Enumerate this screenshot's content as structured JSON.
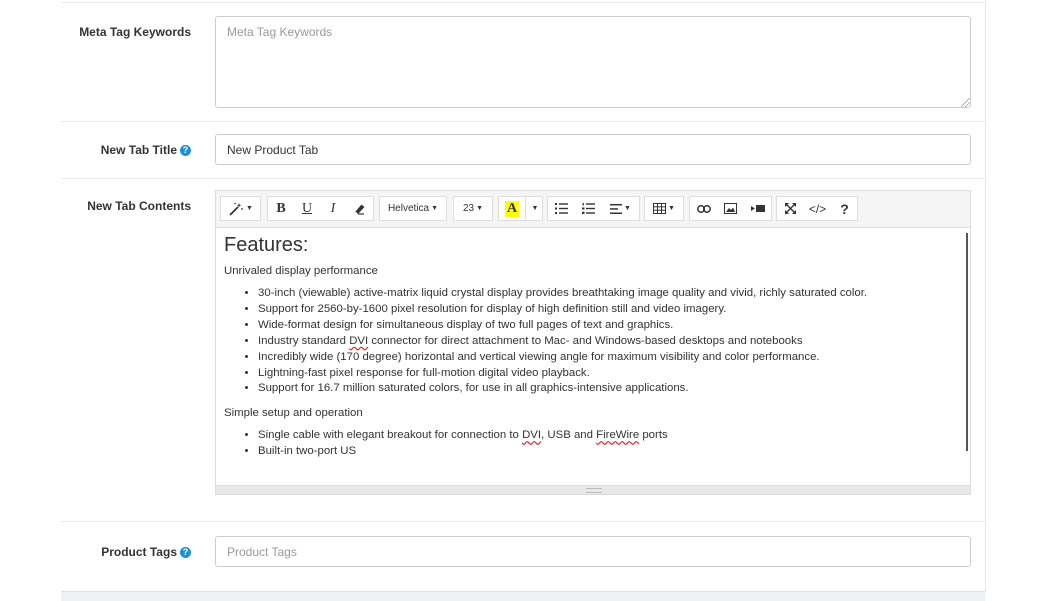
{
  "form": {
    "meta_keywords": {
      "label": "Meta Tag Keywords",
      "placeholder": "Meta Tag Keywords"
    },
    "new_tab_title": {
      "label": "New Tab Title",
      "value": "New Product Tab",
      "help_icon": "question-circle-icon"
    },
    "new_tab_contents": {
      "label": "New Tab Contents"
    },
    "product_tags": {
      "label": "Product Tags",
      "placeholder": "Product Tags",
      "help_icon": "question-circle-icon"
    }
  },
  "toolbar": {
    "style_icon": "magic-wand-icon",
    "bold": "B",
    "underline": "U",
    "italic": "I",
    "eraser_icon": "eraser-icon",
    "font_family": "Helvetica",
    "font_size": "23",
    "color_letter": "A",
    "help": "?",
    "code": "</>",
    "colors": {
      "highlight": "#ffff00"
    }
  },
  "editor": {
    "heading": "Features:",
    "section1": "Unrivaled display performance",
    "list1": [
      "30-inch (viewable) active-matrix liquid crystal display provides breathtaking image quality and vivid, richly saturated color.",
      "Support for 2560-by-1600 pixel resolution for display of high definition still and video imagery.",
      "Wide-format design for simultaneous display of two full pages of text and graphics.",
      "Industry standard |DVI| connector for direct attachment to Mac- and Windows-based desktops and notebooks",
      "Incredibly wide (170 degree) horizontal and vertical viewing angle for maximum visibility and color performance.",
      "Lightning-fast pixel response for full-motion digital video playback.",
      "Support for 16.7 million saturated colors, for use in all graphics-intensive applications."
    ],
    "section2": "Simple setup and operation",
    "list2": [
      "Single cable with elegant breakout for connection to |DVI|, USB and |FireWire| ports",
      "Built-in two-port US"
    ]
  }
}
